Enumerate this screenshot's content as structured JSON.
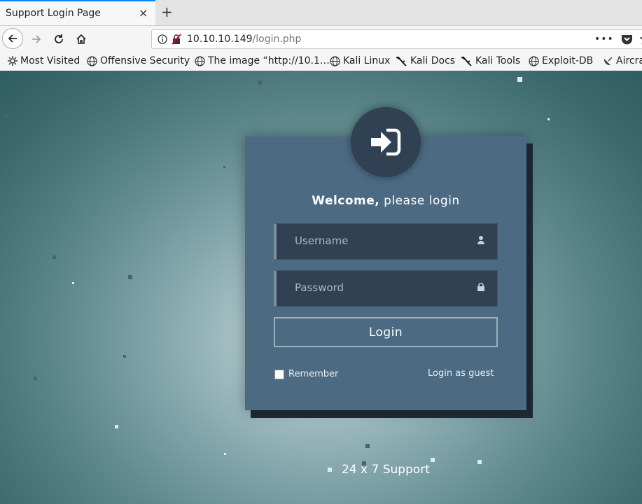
{
  "browser": {
    "tab_title": "Support Login Page",
    "tab_close": "×",
    "new_tab": "+",
    "url_host": "10.10.10.149",
    "url_path": "/login.php",
    "bookmarks": [
      {
        "label": "Most Visited",
        "icon": "gear-icon"
      },
      {
        "label": "Offensive Security",
        "icon": "globe-icon"
      },
      {
        "label": "The image “http://10.1…",
        "icon": "globe-icon"
      },
      {
        "label": "Kali Linux",
        "icon": "globe-icon"
      },
      {
        "label": "Kali Docs",
        "icon": "kali-dragon-icon"
      },
      {
        "label": "Kali Tools",
        "icon": "kali-dragon-icon"
      },
      {
        "label": "Exploit-DB",
        "icon": "globe-icon"
      },
      {
        "label": "Aircra",
        "icon": "satellite-dish-icon"
      }
    ]
  },
  "login": {
    "welcome_bold": "Welcome,",
    "welcome_rest": " please login",
    "username_placeholder": "Username",
    "password_placeholder": "Password",
    "login_button": "Login",
    "remember_label": "Remember",
    "guest_link": "Login as guest"
  },
  "footer": {
    "support": "24 x 7 Support"
  },
  "colors": {
    "card": "#4c6b82",
    "field": "#2f4152",
    "avatar": "#2f4152",
    "accent_tab": "#0a84ff"
  }
}
